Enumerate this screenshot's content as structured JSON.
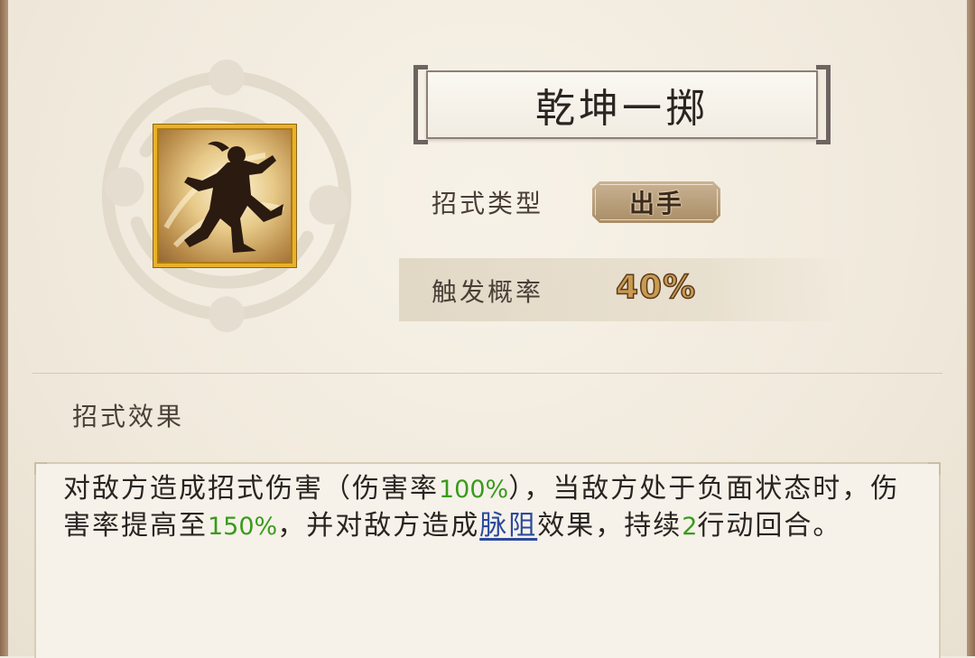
{
  "skill": {
    "name": "乾坤一掷",
    "icon": "silhouette-martial-artist-icon",
    "type_label": "招式类型",
    "type_value": "出手",
    "probability_label": "触发概率",
    "probability_value": "40%"
  },
  "effect": {
    "section_title": "招式效果",
    "parts": {
      "p1": "对敌方造成招式伤害（伤害率",
      "v1": "100%",
      "p2": "），当敌方处于负面状态时，伤害率提高至",
      "v2": "150%",
      "p3": "，并对敌方造成",
      "link": "脉阻",
      "p4": "效果，持续",
      "v3": "2",
      "p5": "行动回合。"
    }
  },
  "colors": {
    "background": "#f1ebdf",
    "highlight_green": "#3a9a1c",
    "link_blue": "#2b4a9c",
    "icon_border_gold": "#e8b12a",
    "probability_gold": "#c89a52"
  }
}
